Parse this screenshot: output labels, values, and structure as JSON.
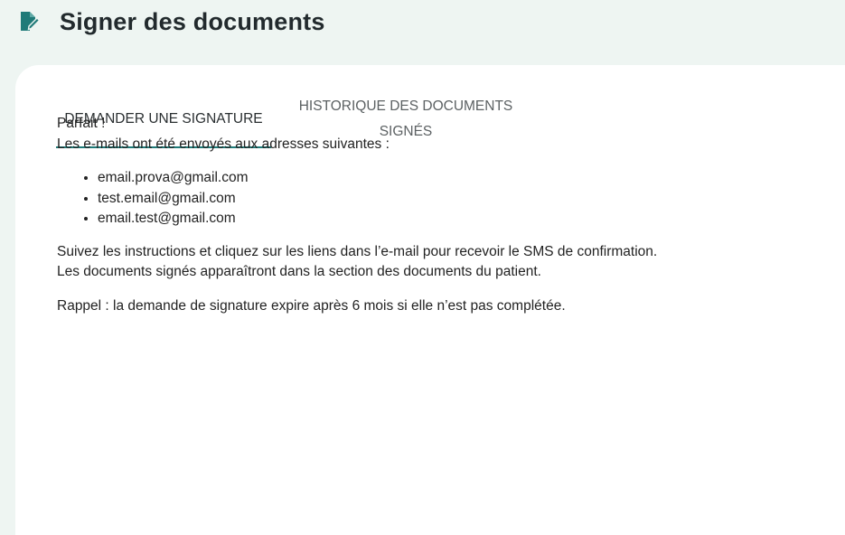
{
  "header": {
    "title": "Signer des documents",
    "icon": "document-sign-icon",
    "icon_color": "#1f7a78"
  },
  "tabs": [
    {
      "label": "DEMANDER UNE SIGNATURE",
      "active": true
    },
    {
      "label": "HISTORIQUE DES DOCUMENTS SIGNÉS",
      "active": false
    }
  ],
  "message": {
    "greeting": "Parfait !",
    "intro": "Les e-mails ont été envoyés aux adresses suivantes :",
    "emails": [
      "email.prova@gmail.com",
      "test.email@gmail.com",
      "email.test@gmail.com"
    ],
    "instructions_line1": "Suivez les instructions et cliquez sur les liens dans l’e-mail pour recevoir le SMS de confirmation.",
    "instructions_line2": "Les documents signés apparaîtront dans la section des documents du patient.",
    "reminder": "Rappel : la demande de signature expire après 6 mois si elle n’est pas complétée."
  },
  "colors": {
    "accent": "#1f7a78",
    "background": "#eef5f2",
    "card": "#ffffff"
  }
}
